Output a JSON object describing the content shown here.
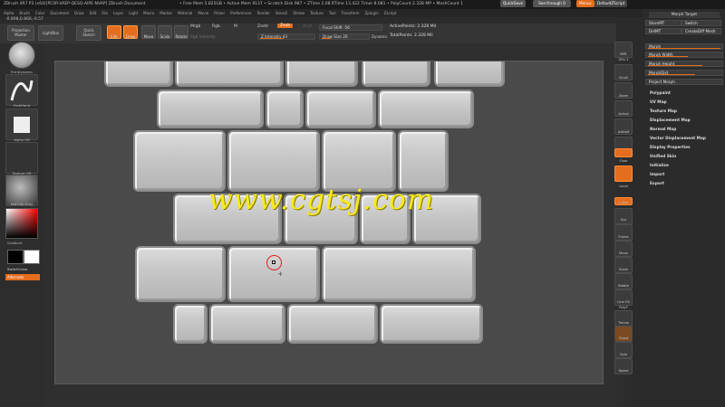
{
  "titlebar": {
    "left": "ZBrush 4R7 P3 (x64)[PC0R-VAEP-QESQ-AIPE-NVAP]   ZBrush Document",
    "mid": "• Free Mem 5.825GB • Active Mem 9137 • Scratch Disk 987 • ZTime 2.08 RTime 13.422 Timer 8.081 • PolyCount 2.328 MP • MeshCount 1",
    "quicksave": "QuickSave",
    "seethrough": "See-through 0",
    "menus": "Menus",
    "defaultzscript": "DefaultZScript"
  },
  "menubar": [
    "Alpha",
    "Brush",
    "Color",
    "Document",
    "Draw",
    "Edit",
    "File",
    "Layer",
    "Light",
    "Macro",
    "Marker",
    "Material",
    "Movie",
    "Picker",
    "Preferences",
    "Render",
    "Stencil",
    "Stroke",
    "Texture",
    "Tool",
    "Transform",
    "Zplugin",
    "Zscript"
  ],
  "coords": "-0.898,0.866,-0.57",
  "toolbar": {
    "projection_master": "Projection Master",
    "lightbox": "LightBox",
    "quick_sketch": "Quick Sketch",
    "edit": "Edit",
    "draw": "Draw",
    "move": "Move",
    "scale": "Scale",
    "rotate": "Rotate",
    "mrgb": "Mrgb",
    "rgb": "Rgb",
    "m": "M",
    "rgb_intensity": "Rgb Intensity",
    "zadd": "Zadd",
    "zsub": "Zsub",
    "zcut": "Zcut",
    "z_intensity": "Z Intensity 43",
    "focal_shift": "Focal Shift -56",
    "draw_size": "Draw Size 20",
    "dynamic": "Dynamic",
    "active_points": "ActivePoints: 2.328 Mil",
    "total_points": "TotalPoints: 2.328 Mil"
  },
  "leftshelf": {
    "brush_label": "TrimDynamic",
    "stroke_label": "FreeHand",
    "alpha_label": "Alpha Off",
    "texture_label": "Texture Off",
    "material_label": "MatCap Gray",
    "gradient": "Gradient",
    "switch_color": "SwitchColor",
    "alternate": "Alternate"
  },
  "watermark": "www.cgtsj.com",
  "rightshelf": [
    {
      "name": "bpr",
      "label": "BPR"
    },
    {
      "name": "spix",
      "label": "SPix 3"
    },
    {
      "name": "scroll",
      "label": "Scroll"
    },
    {
      "name": "zoom",
      "label": "Zoom"
    },
    {
      "name": "actual",
      "label": "Actual"
    },
    {
      "name": "aahalf",
      "label": "AAHalf"
    },
    {
      "name": "persp",
      "label": "Persp"
    },
    {
      "name": "floor",
      "label": "Floor"
    },
    {
      "name": "local",
      "label": "Local"
    },
    {
      "name": "lsym",
      "label": "L.Sym"
    },
    {
      "name": "xyz",
      "label": "Xyz"
    },
    {
      "name": "frame",
      "label": "Frame"
    },
    {
      "name": "move",
      "label": "Move"
    },
    {
      "name": "scale",
      "label": "Scale"
    },
    {
      "name": "rotate",
      "label": "Rotate"
    },
    {
      "name": "linefill",
      "label": "Line Fill"
    },
    {
      "name": "polyf",
      "label": "PolyF"
    },
    {
      "name": "transp",
      "label": "Transp"
    },
    {
      "name": "ghost",
      "label": "Ghost"
    },
    {
      "name": "solo",
      "label": "Solo"
    },
    {
      "name": "xpose",
      "label": "Xpose"
    }
  ],
  "panel": {
    "morph_target": "Morph Target",
    "storemt": "StoreMT",
    "switch": "Switch",
    "delmt": "DelMT",
    "createdifmesh": "CreateDiff Mesh",
    "morph": "Morph",
    "morph_width": "Morph Width",
    "morph_height": "Morph Height",
    "morphdist": "MorphDist",
    "project_morph": "Project Morph",
    "items": [
      "Polypaint",
      "UV Map",
      "Texture Map",
      "Displacement Map",
      "Normal Map",
      "Vector Displacement Map",
      "Display Properties",
      "Unified Skin",
      "Initialize",
      "Import",
      "Export"
    ]
  },
  "colors": {
    "accent": "#e46d1e",
    "watermark": "#f7ea1b"
  }
}
